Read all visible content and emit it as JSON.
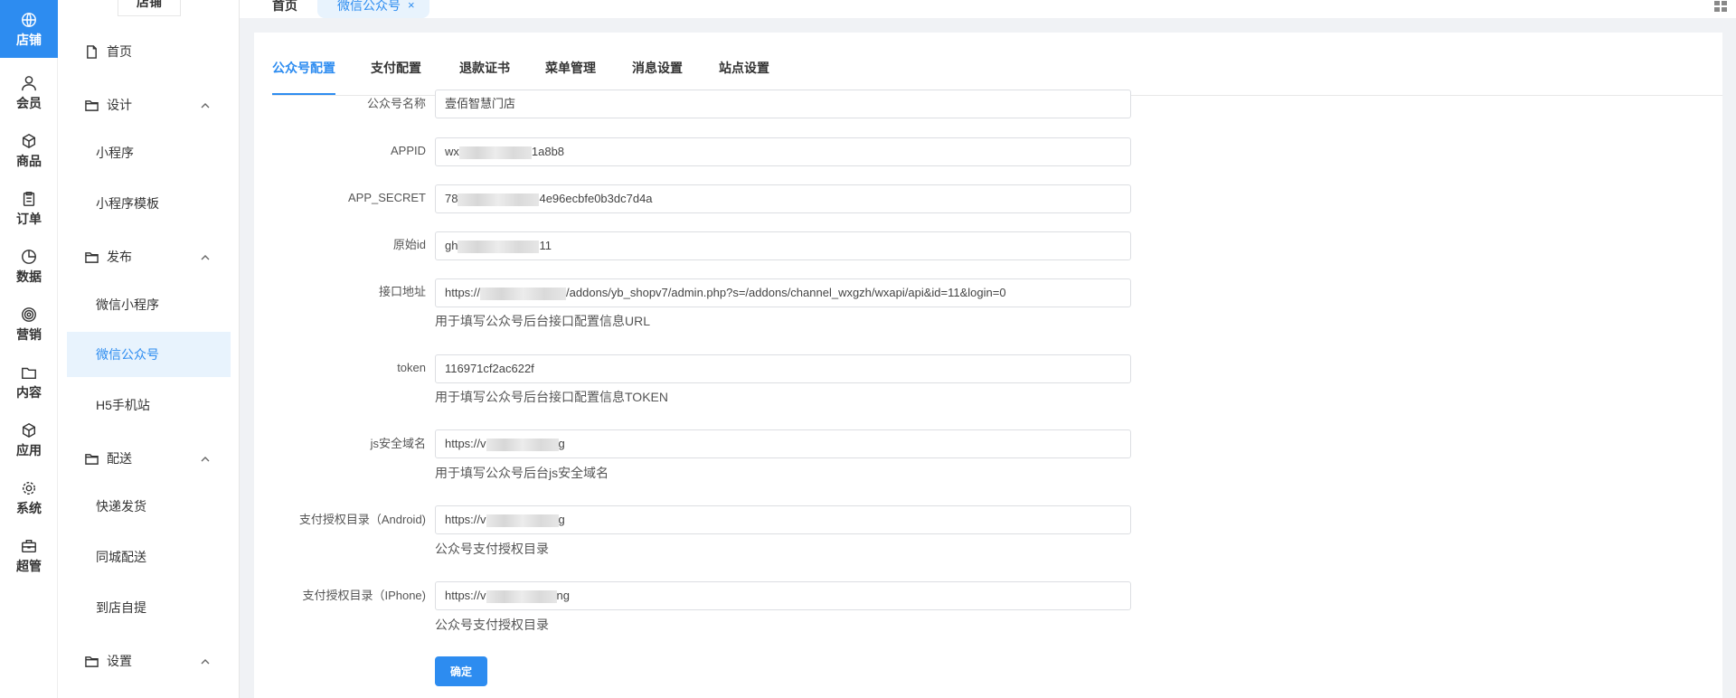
{
  "rail": [
    {
      "label": "店铺",
      "icon": "store-icon"
    },
    {
      "label": "会员",
      "icon": "user-icon"
    },
    {
      "label": "商品",
      "icon": "box-icon"
    },
    {
      "label": "订单",
      "icon": "clipboard-icon"
    },
    {
      "label": "数据",
      "icon": "pie-chart-icon"
    },
    {
      "label": "营销",
      "icon": "target-icon"
    },
    {
      "label": "内容",
      "icon": "folder-icon"
    },
    {
      "label": "应用",
      "icon": "cube-icon"
    },
    {
      "label": "系统",
      "icon": "gear-icon"
    },
    {
      "label": "超管",
      "icon": "toolbox-icon"
    }
  ],
  "sidebar": {
    "title": "店铺",
    "items": [
      {
        "label": "首页",
        "level": 0,
        "icon": "file-icon"
      },
      {
        "label": "设计",
        "level": 0,
        "icon": "folder-icon",
        "expanded": true
      },
      {
        "label": "小程序",
        "level": 1
      },
      {
        "label": "小程序模板",
        "level": 1
      },
      {
        "label": "发布",
        "level": 0,
        "icon": "folder-icon",
        "expanded": true
      },
      {
        "label": "微信小程序",
        "level": 1
      },
      {
        "label": "微信公众号",
        "level": 1,
        "active": true
      },
      {
        "label": "H5手机站",
        "level": 1
      },
      {
        "label": "配送",
        "level": 0,
        "icon": "folder-icon",
        "expanded": true
      },
      {
        "label": "快递发货",
        "level": 1
      },
      {
        "label": "同城配送",
        "level": 1
      },
      {
        "label": "到店自提",
        "level": 1
      },
      {
        "label": "设置",
        "level": 0,
        "icon": "folder-icon",
        "expanded": true
      }
    ]
  },
  "top_tabs": {
    "home": "首页",
    "current": "微信公众号",
    "close": "×"
  },
  "tabs": [
    "公众号配置",
    "支付配置",
    "退款证书",
    "菜单管理",
    "消息设置",
    "站点设置"
  ],
  "form": {
    "name": {
      "label": "公众号名称",
      "value": "壹佰智慧门店"
    },
    "appid": {
      "label": "APPID",
      "prefix": "wx",
      "suffix": "1a8b8"
    },
    "secret": {
      "label": "APP_SECRET",
      "prefix": "78",
      "suffix": "4e96ecbfe0b3dc7d4a"
    },
    "origin_id": {
      "label": "原始id",
      "prefix": "gh",
      "suffix": "11"
    },
    "api_url": {
      "label": "接口地址",
      "prefix": "https://",
      "suffix": "/addons/yb_shopv7/admin.php?s=/addons/channel_wxgzh/wxapi/api&id=11&login=0",
      "help": "用于填写公众号后台接口配置信息URL"
    },
    "token": {
      "label": "token",
      "value": "116971cf2ac622f",
      "help": "用于填写公众号后台接口配置信息TOKEN"
    },
    "js_domain": {
      "label": "js安全域名",
      "prefix": "https://v",
      "suffix": "g",
      "help": "用于填写公众号后台js安全域名"
    },
    "pay_android": {
      "label": "支付授权目录（Android)",
      "prefix": "https://v",
      "suffix": "g",
      "help": "公众号支付授权目录"
    },
    "pay_iphone": {
      "label": "支付授权目录（IPhone)",
      "prefix": "https://v",
      "suffix": "ng",
      "help": "公众号支付授权目录"
    },
    "submit": "确定"
  },
  "colors": {
    "accent": "#2d8cf0",
    "accent_light": "#e8f3fd"
  }
}
